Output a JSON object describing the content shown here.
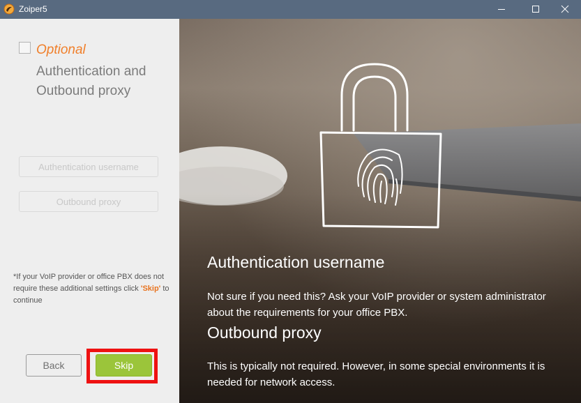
{
  "window": {
    "title": "Zoiper5",
    "icon": "zoiper-logo-icon"
  },
  "left_panel": {
    "optional_label": "Optional",
    "section_title": "Authentication and Outbound proxy",
    "auth_username_placeholder": "Authentication username",
    "outbound_proxy_placeholder": "Outbound proxy",
    "note_prefix": "*If your VoIP provider or office PBX does not require these additional settings click ",
    "note_skip": "'Skip'",
    "note_suffix": " to continue",
    "back_label": "Back",
    "skip_label": "Skip"
  },
  "right_panel": {
    "auth_heading": "Authentication username",
    "auth_description": "Not sure if you need this? Ask your VoIP provider or system administrator about the requirements for your office PBX.",
    "proxy_heading": "Outbound proxy",
    "proxy_description": "This is typically not required. However, in some special environments it is needed for network access."
  },
  "colors": {
    "titlebar": "#586a80",
    "accent_orange": "#f07f2a",
    "skip_green": "#9bc53a",
    "highlight_red": "#ee1111"
  }
}
